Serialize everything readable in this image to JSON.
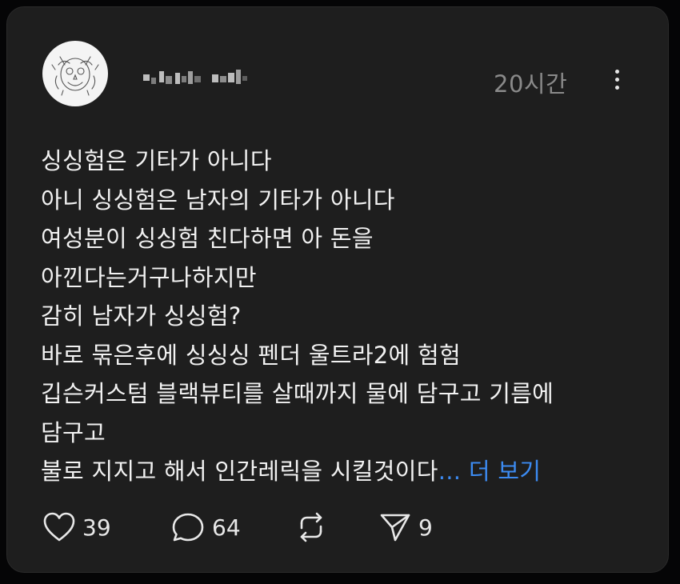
{
  "post": {
    "timestamp": "20시간",
    "username_obscured": "(blurred username)",
    "lines": [
      "싱싱험은 기타가 아니다",
      "아니 싱싱험은 남자의 기타가 아니다",
      "여성분이 싱싱험 친다하면 아 돈을",
      "아낀다는거구나하지만",
      "감히 남자가 싱싱험?",
      "바로 묶은후에 싱싱싱 펜더 울트라2에 험험",
      "깁슨커스텀 블랙뷰티를 살때까지 물에 담구고 기름에",
      "담구고"
    ],
    "last_line": "불로 지지고 해서 인간레릭을 시킬것이다",
    "ellipsis": "...",
    "more_label": "더 보기"
  },
  "actions": {
    "likes": "39",
    "comments": "64",
    "shares": "9"
  },
  "icons": {
    "more": "more-vertical-icon",
    "like": "heart-icon",
    "comment": "comment-bubble-icon",
    "repost": "repost-icon",
    "share": "send-icon"
  },
  "colors": {
    "background": "#1e1e1e",
    "text": "#f2f2f2",
    "muted": "#8a8a8a",
    "link": "#3c8bf2"
  }
}
